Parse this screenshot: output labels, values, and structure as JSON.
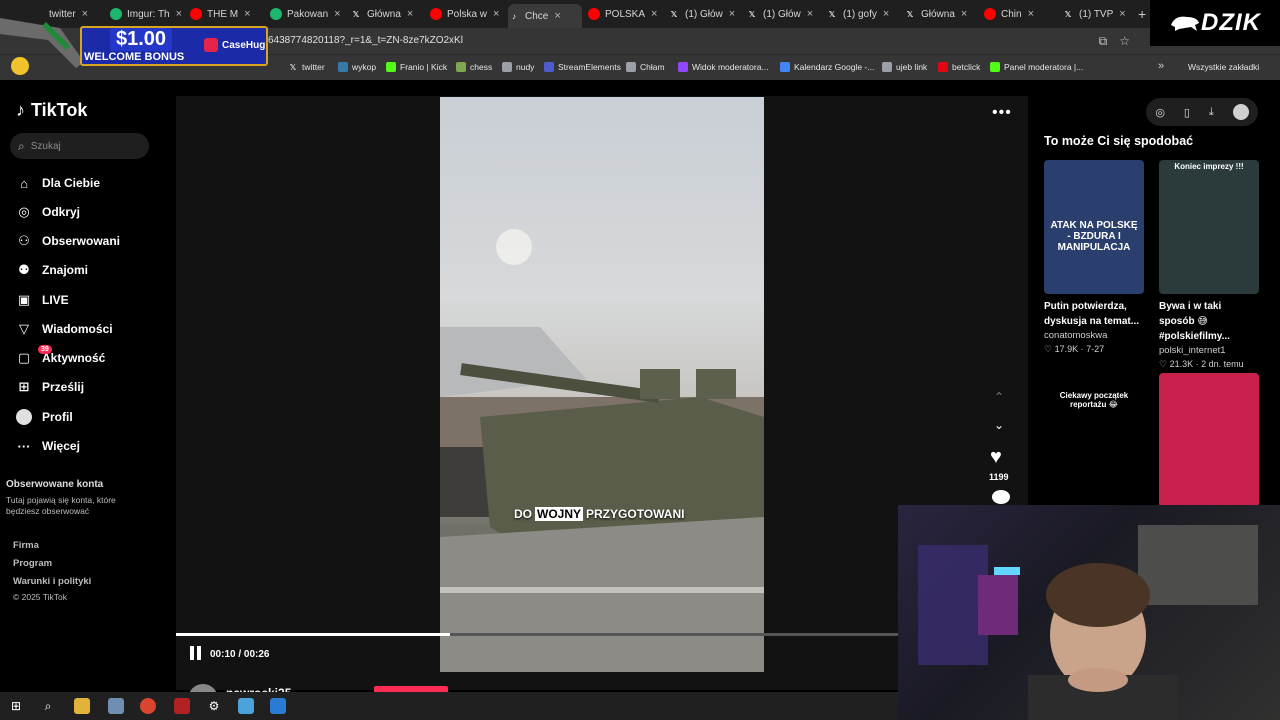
{
  "browser": {
    "tabs": [
      {
        "title": "twitter",
        "icon": "chrome-icon",
        "color": "#ffffff"
      },
      {
        "title": "Imgur: Th",
        "icon": "imgur-icon",
        "color": "#1bb76e"
      },
      {
        "title": "THE M",
        "icon": "youtube-icon",
        "color": "#ff0000"
      },
      {
        "title": "Pakowan",
        "icon": "sheets-icon",
        "color": "#1bb76e"
      },
      {
        "title": "Główna",
        "icon": "x-icon",
        "color": "#ffffff"
      },
      {
        "title": "Polska w",
        "icon": "youtube-icon",
        "color": "#ff0000"
      },
      {
        "title": "Chce",
        "icon": "tiktok-icon",
        "color": "#ffffff"
      },
      {
        "title": "POLSKA",
        "icon": "youtube-icon",
        "color": "#ff0000"
      },
      {
        "title": "(1) Głów",
        "icon": "x-icon",
        "color": "#ffffff"
      },
      {
        "title": "(1) Głów",
        "icon": "x-icon",
        "color": "#ffffff"
      },
      {
        "title": "(1) gofy",
        "icon": "x-icon",
        "color": "#ffffff"
      },
      {
        "title": "Główna",
        "icon": "x-icon",
        "color": "#ffffff"
      },
      {
        "title": "Chin",
        "icon": "youtube-icon",
        "color": "#ff0000"
      },
      {
        "title": "(1) TVP",
        "icon": "x-icon",
        "color": "#ffffff"
      }
    ],
    "new_tab": "+",
    "url": "64387748201​18?_r=1&_t=ZN-8ze7kZO2xKl",
    "bookmarks": [
      {
        "label": "twitter",
        "icon": "x-icon"
      },
      {
        "label": "wykop",
        "icon": "wykop-icon"
      },
      {
        "label": "Franio | Kick",
        "icon": "kick-icon"
      },
      {
        "label": "chess",
        "icon": "chess-icon"
      },
      {
        "label": "nudy",
        "icon": "folder-icon"
      },
      {
        "label": "StreamElements",
        "icon": "streamelements-icon"
      },
      {
        "label": "Chłam",
        "icon": "globe-icon"
      },
      {
        "label": "Widok moderatora...",
        "icon": "twitch-icon"
      },
      {
        "label": "Kalendarz Google -...",
        "icon": "calendar-icon"
      },
      {
        "label": "ujeb link",
        "icon": "link-icon"
      },
      {
        "label": "betclick",
        "icon": "betclick-icon"
      },
      {
        "label": "Panel moderatora |...",
        "icon": "kick-icon"
      }
    ],
    "bookmarks_all": "Wszystkie zakładki"
  },
  "ad": {
    "price": "$1.00",
    "bonus": "WELCOME BONUS",
    "brand": "CaseHug"
  },
  "logo_overlay": "DZIK",
  "tiktok": {
    "logo": "TikTok",
    "search_placeholder": "Szukaj",
    "nav": [
      {
        "label": "Dla Ciebie",
        "icon": "home-icon"
      },
      {
        "label": "Odkryj",
        "icon": "compass-icon"
      },
      {
        "label": "Obserwowani",
        "icon": "user-follow-icon"
      },
      {
        "label": "Znajomi",
        "icon": "friends-icon"
      },
      {
        "label": "LIVE",
        "icon": "live-icon"
      },
      {
        "label": "Wiadomości",
        "icon": "message-icon"
      },
      {
        "label": "Aktywność",
        "icon": "activity-icon",
        "badge": "39"
      },
      {
        "label": "Prześlij",
        "icon": "upload-icon"
      },
      {
        "label": "Profil",
        "icon": "profile-icon"
      },
      {
        "label": "Więcej",
        "icon": "more-icon"
      }
    ],
    "followed_title": "Obserwowane konta",
    "followed_desc": "Tutaj pojawią się konta, które będziesz obserwować",
    "footer": [
      "Firma",
      "Program",
      "Warunki i polityki"
    ],
    "copyright": "© 2025 TikTok"
  },
  "video": {
    "caption_before": "DO",
    "caption_highlight": "WOJNY",
    "caption_after": "PRZYGOTOWANI",
    "time": "00:10 / 00:26",
    "progress": 0.38,
    "likes": "1199",
    "author": "nawrocki25"
  },
  "recommendations": {
    "title": "To może Ci się spodobać",
    "items": [
      {
        "title": "Putin potwierdza, dyskusja na temat...",
        "author": "conatomoskwa",
        "likes": "17.9K",
        "date": "7-27",
        "overlay": "ATAK NA POLSKĘ - BZDURA I MANIPULACJA",
        "color": "#2a3f6e"
      },
      {
        "title": "Bywa i w taki sposób 😅#polskiefilmy...",
        "author": "polski_internet1",
        "likes": "21.3K",
        "date": "2 dn. temu",
        "overlay": "Koniec imprezy !!!",
        "color": "#2b3a3b"
      },
      {
        "title": "",
        "author": "",
        "likes": "",
        "date": "",
        "overlay": "Ciekawy początek reportażu 😂",
        "color": "#000000"
      },
      {
        "title": "",
        "author": "",
        "likes": "",
        "date": "",
        "overlay": "",
        "color": "#c9204e"
      }
    ]
  }
}
